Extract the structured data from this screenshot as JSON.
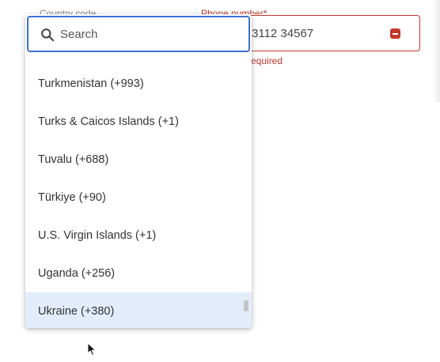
{
  "background_form": {
    "country_code_label": "Country code",
    "phone_label": "Phone number*",
    "phone_value": "3112 34567",
    "error_text": "equired"
  },
  "dropdown": {
    "search": {
      "placeholder": "Search",
      "value": ""
    },
    "items": [
      {
        "label": "Turkmenistan (+993)",
        "selected": false
      },
      {
        "label": "Turks & Caicos Islands (+1)",
        "selected": false
      },
      {
        "label": "Tuvalu (+688)",
        "selected": false
      },
      {
        "label": "Türkiye (+90)",
        "selected": false
      },
      {
        "label": "U.S. Virgin Islands (+1)",
        "selected": false
      },
      {
        "label": "Uganda (+256)",
        "selected": false
      },
      {
        "label": "Ukraine (+380)",
        "selected": true
      }
    ]
  },
  "colors": {
    "accent": "#3d6fd1",
    "error": "#c0392b",
    "selected_bg": "#e3ecfa"
  }
}
